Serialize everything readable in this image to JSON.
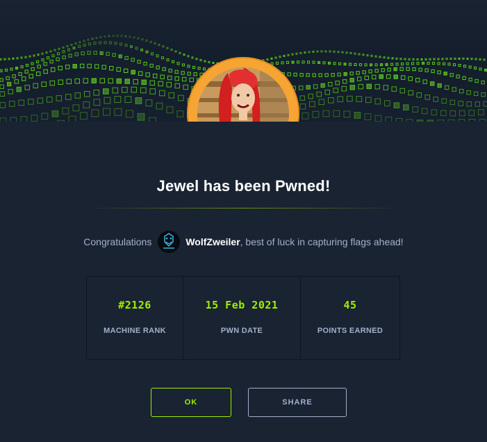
{
  "banner": {
    "graphic": "green-digital-wave"
  },
  "machine": {
    "avatar": "red-haired-woman-avatar",
    "ring_color": "#f6a534"
  },
  "title": "Jewel has been Pwned!",
  "congrats": {
    "prefix": "Congratulations",
    "username": "WolfZweiler",
    "suffix": ", best of luck in capturing flags ahead!"
  },
  "stats": [
    {
      "value": "#2126",
      "label": "MACHINE RANK"
    },
    {
      "value": "15 Feb 2021",
      "label": "PWN DATE"
    },
    {
      "value": "45",
      "label": "POINTS EARNED"
    }
  ],
  "buttons": {
    "ok": "OK",
    "share": "SHARE"
  },
  "colors": {
    "accent": "#9fef00",
    "background": "#1a2332",
    "text_muted": "#a4b1cd"
  }
}
